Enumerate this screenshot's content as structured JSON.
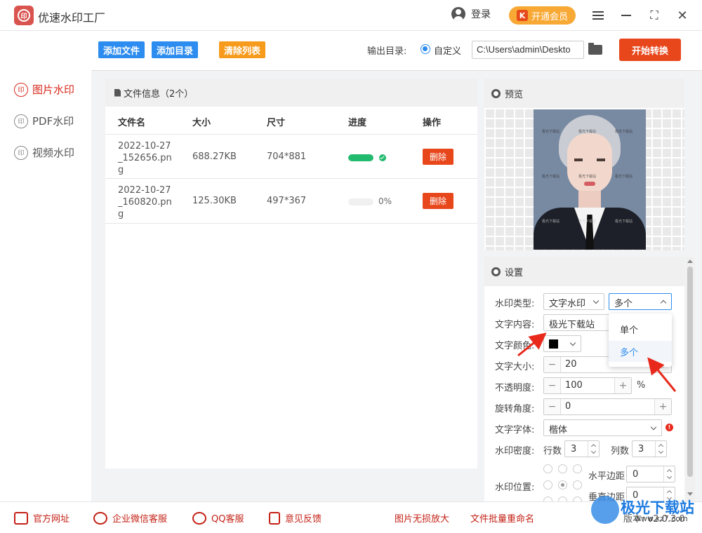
{
  "app": {
    "title": "优速水印工厂",
    "login": "登录",
    "vip": "开通会员",
    "logo_text": "印"
  },
  "sidebar": {
    "items": [
      {
        "label": "图片水印",
        "icon": "印",
        "active": true
      },
      {
        "label": "PDF水印",
        "icon": "印",
        "active": false
      },
      {
        "label": "视频水印",
        "icon": "印",
        "active": false
      }
    ]
  },
  "toolbar": {
    "add_file": "添加文件",
    "add_dir": "添加目录",
    "clear_list": "清除列表",
    "output_label": "输出目录:",
    "output_option": "自定义",
    "output_path": "C:\\Users\\admin\\Deskto",
    "start": "开始转换"
  },
  "files": {
    "header": "文件信息（2个）",
    "columns": {
      "name": "文件名",
      "size": "大小",
      "dim": "尺寸",
      "progress": "进度",
      "action": "操作"
    },
    "rows": [
      {
        "name": "2022-10-27_152656.png",
        "size": "688.27KB",
        "dim": "704*881",
        "progress": 1.0,
        "progress_text": "",
        "delete": "删除"
      },
      {
        "name": "2022-10-27_160820.png",
        "size": "125.30KB",
        "dim": "497*367",
        "progress": 0.0,
        "progress_text": "0%",
        "delete": "删除"
      }
    ]
  },
  "preview": {
    "title": "预览",
    "watermark_text": "极光下载站"
  },
  "settings": {
    "title": "设置",
    "type_label": "水印类型:",
    "type_value": "文字水印",
    "mode_value": "多个",
    "content_label": "文字内容:",
    "content_value": "极光下载站",
    "color_label": "文字颜色:",
    "color_value": "#000000",
    "size_label": "文字大小:",
    "size_value": "20",
    "opacity_label": "不透明度:",
    "opacity_value": "100",
    "opacity_unit": "%",
    "rotate_label": "旋转角度:",
    "rotate_value": "0",
    "font_label": "文字字体:",
    "font_value": "楷体",
    "density_label": "水印密度:",
    "rows_label": "行数",
    "rows_value": "3",
    "cols_label": "列数",
    "cols_value": "3",
    "position_label": "水印位置:",
    "hmargin_label": "水平边距",
    "hmargin_value": "0",
    "vmargin_label": "垂直边距",
    "vmargin_value": "0"
  },
  "dropdown": {
    "options": [
      "单个",
      "多个"
    ],
    "selected": "多个"
  },
  "footer": {
    "links": [
      "官方网址",
      "企业微信客服",
      "QQ客服",
      "意见反馈"
    ],
    "tools": [
      "图片无损放大",
      "文件批量重命名"
    ],
    "version": "版本: v2.0.3.0"
  },
  "brand_watermark": {
    "name": "极光下载站",
    "url": "www.xz7.com"
  },
  "colors": {
    "accent": "#2d8cf0",
    "danger": "#e8471c",
    "brand_red": "#d9291c",
    "vip": "#f8a935"
  }
}
